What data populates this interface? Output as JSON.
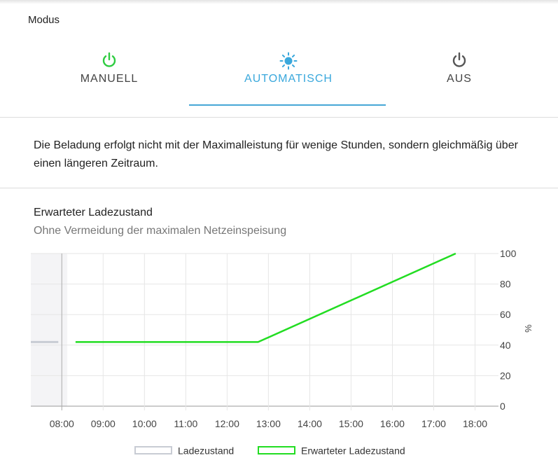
{
  "modus": {
    "title": "Modus",
    "options": [
      {
        "label": "MANUELL",
        "icon": "power-icon",
        "color": "#2ecc40"
      },
      {
        "label": "AUTOMATISCH",
        "icon": "sun-icon",
        "color": "#3aa8dc",
        "selected": true
      },
      {
        "label": "AUS",
        "icon": "power-icon",
        "color": "#555555"
      }
    ]
  },
  "description": "Die Beladung erfolgt nicht mit der Maximalleistung für wenige Stunden, sondern gleichmäßig über einen längeren Zeitraum.",
  "chart": {
    "title": "Erwarteter Ladezustand",
    "subtitle": "Ohne Vermeidung der maximalen Netzeinspeisung"
  },
  "colors": {
    "accent": "#46a7d6",
    "expected_line": "#22dd22",
    "actual_line": "#c8ccd4"
  },
  "chart_data": {
    "type": "line",
    "x_ticks": [
      "08:00",
      "09:00",
      "10:00",
      "11:00",
      "12:00",
      "13:00",
      "14:00",
      "15:00",
      "16:00",
      "17:00",
      "18:00"
    ],
    "y_ticks": [
      0,
      20,
      40,
      60,
      80,
      100
    ],
    "ylabel": "%",
    "ylim": [
      0,
      100
    ],
    "xlim": [
      "07:15",
      "18:30"
    ],
    "grid": true,
    "legend_position": "bottom",
    "series": [
      {
        "name": "Ladezustand",
        "color": "#c8ccd4",
        "points": [
          [
            "07:15",
            42
          ],
          [
            "07:55",
            42
          ]
        ]
      },
      {
        "name": "Erwarteter Ladezustand",
        "color": "#22dd22",
        "points": [
          [
            "08:20",
            42
          ],
          [
            "12:45",
            42
          ],
          [
            "17:32",
            100
          ]
        ]
      }
    ]
  }
}
